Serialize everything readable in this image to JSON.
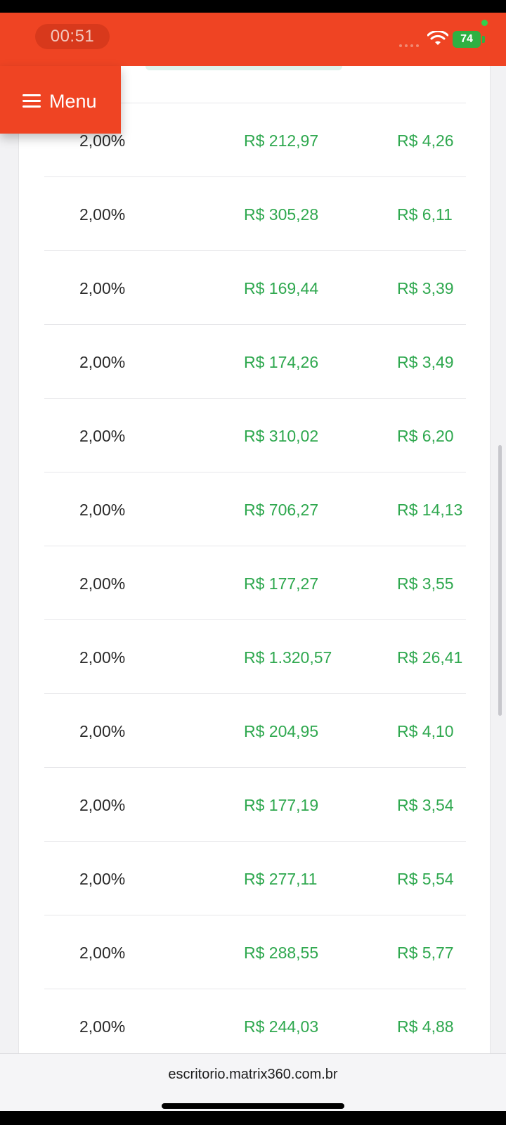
{
  "status": {
    "timer": "00:51",
    "battery": "74",
    "colors": {
      "bar": "#ef4423",
      "battery": "#2fb042"
    }
  },
  "menu": {
    "label": "Menu",
    "icon": "hamburger-icon"
  },
  "table": {
    "rows": [
      {
        "rate": "2,00%",
        "base": "R$ 212,97",
        "commission": "R$ 4,26"
      },
      {
        "rate": "2,00%",
        "base": "R$ 305,28",
        "commission": "R$ 6,11"
      },
      {
        "rate": "2,00%",
        "base": "R$ 169,44",
        "commission": "R$ 3,39"
      },
      {
        "rate": "2,00%",
        "base": "R$ 174,26",
        "commission": "R$ 3,49"
      },
      {
        "rate": "2,00%",
        "base": "R$ 310,02",
        "commission": "R$ 6,20"
      },
      {
        "rate": "2,00%",
        "base": "R$ 706,27",
        "commission": "R$ 14,13"
      },
      {
        "rate": "2,00%",
        "base": "R$ 177,27",
        "commission": "R$ 3,55"
      },
      {
        "rate": "2,00%",
        "base": "R$ 1.320,57",
        "commission": "R$ 26,41"
      },
      {
        "rate": "2,00%",
        "base": "R$ 204,95",
        "commission": "R$ 4,10"
      },
      {
        "rate": "2,00%",
        "base": "R$ 177,19",
        "commission": "R$ 3,54"
      },
      {
        "rate": "2,00%",
        "base": "R$ 277,11",
        "commission": "R$ 5,54"
      },
      {
        "rate": "2,00%",
        "base": "R$ 288,55",
        "commission": "R$ 5,77"
      },
      {
        "rate": "2,00%",
        "base": "R$ 244,03",
        "commission": "R$ 4,88"
      }
    ],
    "colors": {
      "amount": "#2fa84f",
      "rate": "#2b2b2b"
    }
  },
  "browser": {
    "url": "escritorio.matrix360.com.br"
  }
}
